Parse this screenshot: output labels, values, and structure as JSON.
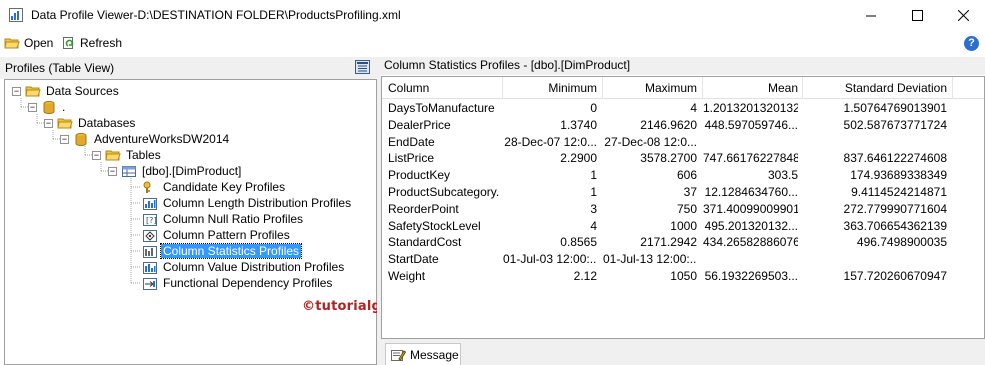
{
  "window": {
    "title": "Data Profile Viewer-D:\\DESTINATION FOLDER\\ProductsProfiling.xml",
    "minimize_glyph": "—",
    "maximize_glyph": "☐",
    "close_glyph": "✕"
  },
  "toolbar": {
    "open_label": "Open",
    "refresh_label": "Refresh",
    "help_glyph": "?"
  },
  "left_pane": {
    "header": "Profiles (Table View)",
    "tree": {
      "data_sources": "Data Sources",
      "server": ".",
      "databases": "Databases",
      "database": "AdventureWorksDW2014",
      "tables": "Tables",
      "table": "[dbo].[DimProduct]",
      "profiles": [
        "Candidate Key Profiles",
        "Column Length Distribution Profiles",
        "Column Null Ratio Profiles",
        "Column Pattern Profiles",
        "Column Statistics Profiles",
        "Column Value Distribution Profiles",
        "Functional Dependency Profiles"
      ],
      "selected_profile": "Column Statistics Profiles"
    },
    "watermark": "©tutorialgateway.org"
  },
  "right_pane": {
    "header": "Column Statistics Profiles  -  [dbo].[DimProduct]",
    "columns": [
      "Column",
      "Minimum",
      "Maximum",
      "Mean",
      "Standard Deviation"
    ],
    "rows": [
      [
        "DaysToManufacture",
        "0",
        "4",
        "1.2013201320132",
        "1.50764769013901"
      ],
      [
        "DealerPrice",
        "1.3740",
        "2146.9620",
        "448.597059746...",
        "502.587673771724"
      ],
      [
        "EndDate",
        "28-Dec-07 12:0...",
        "27-Dec-08 12:0...",
        "",
        ""
      ],
      [
        "ListPrice",
        "2.2900",
        "3578.2700",
        "747.66176227848",
        "837.646122274608"
      ],
      [
        "ProductKey",
        "1",
        "606",
        "303.5",
        "174.93689338349"
      ],
      [
        "ProductSubcategory...",
        "1",
        "37",
        "12.1284634760...",
        "9.4114524214871"
      ],
      [
        "ReorderPoint",
        "3",
        "750",
        "371.40099009901",
        "272.779990771604"
      ],
      [
        "SafetyStockLevel",
        "4",
        "1000",
        "495.201320132...",
        "363.706654362139"
      ],
      [
        "StandardCost",
        "0.8565",
        "2171.2942",
        "434.26582886076",
        "496.7498900035"
      ],
      [
        "StartDate",
        "01-Jul-03 12:00:...",
        "01-Jul-13 12:00:...",
        "",
        ""
      ],
      [
        "Weight",
        "2.12",
        "1050",
        "56.1932269503...",
        "157.720260670947"
      ]
    ],
    "message_tab": "Message"
  },
  "colors": {
    "selection": "#3399ff",
    "folder": "#f5c342",
    "database": "#e0a92a",
    "watermark": "#b22222"
  }
}
